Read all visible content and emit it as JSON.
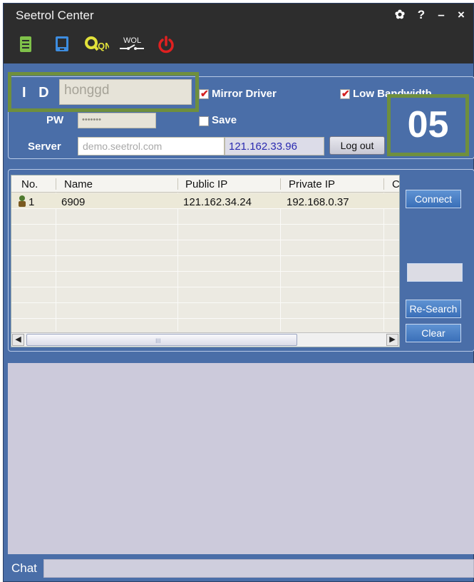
{
  "window": {
    "title": "Seetrol Center",
    "controls": {
      "settings": "✿",
      "help": "?",
      "minimize": "–",
      "close": "×"
    }
  },
  "toolbar": {
    "items": [
      {
        "icon": "document-icon"
      },
      {
        "icon": "monitor-icon"
      },
      {
        "icon": "qn-icon",
        "label": "QN"
      },
      {
        "icon": "wol-icon",
        "label": "WOL"
      },
      {
        "icon": "power-icon"
      }
    ],
    "colors": {
      "green": "#7fc14a",
      "blue": "#3d8de0",
      "yellow": "#e2e23a",
      "red": "#e02020"
    }
  },
  "login": {
    "id_label": "I D",
    "id_value": "honggd",
    "pw_label": "PW",
    "pw_value": "•••••••",
    "server_label": "Server",
    "server_value": "demo.seetrol.com",
    "server_ip": "121.162.33.96",
    "logout_label": "Log out",
    "mirror_driver_label": "Mirror Driver",
    "mirror_driver_checked": true,
    "low_bandwidth_label": "Low Bandwidth",
    "low_bandwidth_checked": true,
    "save_label": "Save",
    "save_checked": false
  },
  "annotation": {
    "number": "05",
    "color": "#6f8f3d"
  },
  "list": {
    "columns": [
      "No.",
      "Name",
      "Public IP",
      "Private IP",
      "C"
    ],
    "rows": [
      {
        "no": "1",
        "name": "6909",
        "public_ip": "121.162.34.24",
        "private_ip": "192.168.0.37",
        "icon": "user-icon"
      }
    ],
    "scroll_grip": "III"
  },
  "buttons": {
    "connect": "Connect",
    "research": "Re-Search",
    "clear": "Clear"
  },
  "chat": {
    "label": "Chat",
    "value": ""
  }
}
